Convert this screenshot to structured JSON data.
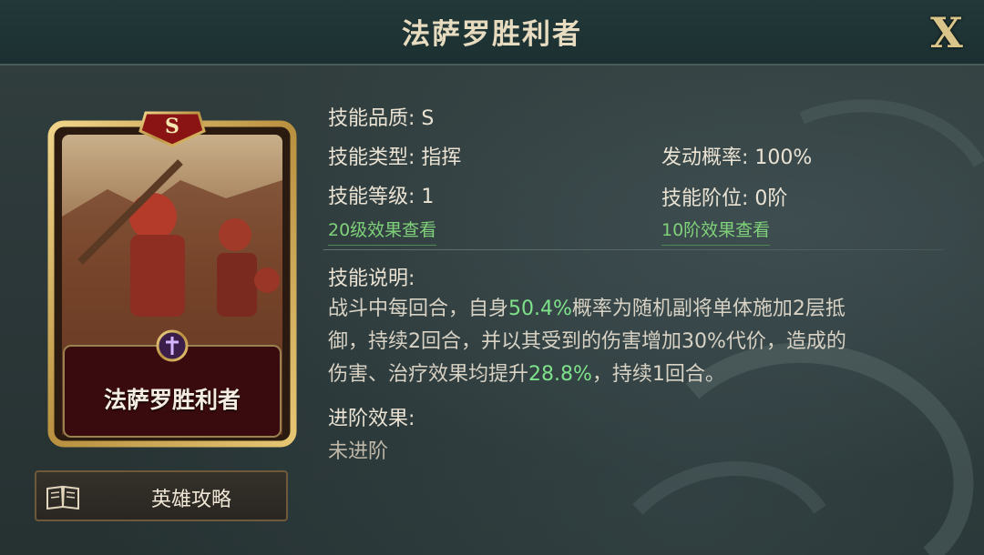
{
  "header": {
    "title": "法萨罗胜利者",
    "close_label": "X"
  },
  "card": {
    "name": "法萨罗胜利者",
    "quality_badge": "S",
    "type_icon": "sword-emblem-icon"
  },
  "guide_button": {
    "label": "英雄攻略",
    "icon": "book-icon"
  },
  "skill": {
    "quality": "技能品质: S",
    "type": "技能类型: 指挥",
    "level": "技能等级: 1",
    "trigger_rate": "发动概率: 100%",
    "tier": "技能阶位: 0阶",
    "lv20_link": "20级效果查看",
    "tier10_link": "10阶效果查看",
    "desc_heading": "技能说明:",
    "desc_parts": {
      "p1": "战斗中每回合，自身",
      "h1": "50.4%",
      "p2": "概率为随机副将单体施加2层抵",
      "p3": "御，持续2回合，并以其受到的伤害增加30%代价，造成的",
      "p4": "伤害、治疗效果均提升",
      "h2": "28.8%",
      "p5": "，持续1回合。"
    },
    "advance_heading": "进阶效果:",
    "advance_value": "未进阶"
  },
  "colors": {
    "highlight": "#7ee28a",
    "link": "#7fd17a",
    "title": "#e8dcc0",
    "gold": "#c9a24a",
    "plate": "#3a0b0e"
  }
}
